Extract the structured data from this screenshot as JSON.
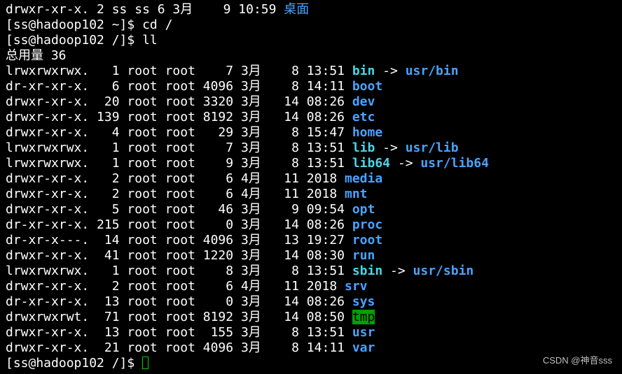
{
  "terminal": {
    "top_line": {
      "prefix": "drwxr-xr-x. 2 ss ss 6 3月    9 10:59 ",
      "name": "桌面"
    },
    "cmd1": "[ss@hadoop102 ~]$ cd /",
    "cmd2": "[ss@hadoop102 /]$ ll",
    "total": "总用量 36",
    "entries": [
      {
        "prefix": "lrwxrwxrwx.   1 root root    7 3月    8 13:51 ",
        "name": "bin",
        "arrow": " -> ",
        "target": "usr/bin"
      },
      {
        "prefix": "dr-xr-xr-x.   6 root root 4096 3月    8 14:11 ",
        "name": "boot",
        "arrow": "",
        "target": ""
      },
      {
        "prefix": "drwxr-xr-x.  20 root root 3320 3月   14 08:26 ",
        "name": "dev",
        "arrow": "",
        "target": ""
      },
      {
        "prefix": "drwxr-xr-x. 139 root root 8192 3月   14 08:26 ",
        "name": "etc",
        "arrow": "",
        "target": ""
      },
      {
        "prefix": "drwxr-xr-x.   4 root root   29 3月    8 15:47 ",
        "name": "home",
        "arrow": "",
        "target": ""
      },
      {
        "prefix": "lrwxrwxrwx.   1 root root    7 3月    8 13:51 ",
        "name": "lib",
        "arrow": " -> ",
        "target": "usr/lib"
      },
      {
        "prefix": "lrwxrwxrwx.   1 root root    9 3月    8 13:51 ",
        "name": "lib64",
        "arrow": " -> ",
        "target": "usr/lib64"
      },
      {
        "prefix": "drwxr-xr-x.   2 root root    6 4月   11 2018 ",
        "name": "media",
        "arrow": "",
        "target": ""
      },
      {
        "prefix": "drwxr-xr-x.   2 root root    6 4月   11 2018 ",
        "name": "mnt",
        "arrow": "",
        "target": ""
      },
      {
        "prefix": "drwxr-xr-x.   5 root root   46 3月    9 09:54 ",
        "name": "opt",
        "arrow": "",
        "target": ""
      },
      {
        "prefix": "dr-xr-xr-x. 215 root root    0 3月   14 08:26 ",
        "name": "proc",
        "arrow": "",
        "target": ""
      },
      {
        "prefix": "dr-xr-x---.  14 root root 4096 3月   13 19:27 ",
        "name": "root",
        "arrow": "",
        "target": ""
      },
      {
        "prefix": "drwxr-xr-x.  41 root root 1220 3月   14 08:30 ",
        "name": "run",
        "arrow": "",
        "target": ""
      },
      {
        "prefix": "lrwxrwxrwx.   1 root root    8 3月    8 13:51 ",
        "name": "sbin",
        "arrow": " -> ",
        "target": "usr/sbin"
      },
      {
        "prefix": "drwxr-xr-x.   2 root root    6 4月   11 2018 ",
        "name": "srv",
        "arrow": "",
        "target": ""
      },
      {
        "prefix": "dr-xr-xr-x.  13 root root    0 3月   14 08:26 ",
        "name": "sys",
        "arrow": "",
        "target": ""
      },
      {
        "prefix": "drwxrwxrwt.  71 root root 8192 3月   14 08:50 ",
        "name": "tmp",
        "arrow": "",
        "target": ""
      },
      {
        "prefix": "drwxr-xr-x.  13 root root  155 3月    8 13:51 ",
        "name": "usr",
        "arrow": "",
        "target": ""
      },
      {
        "prefix": "drwxr-xr-x.  21 root root 4096 3月    8 14:11 ",
        "name": "var",
        "arrow": "",
        "target": ""
      }
    ],
    "prompt": "[ss@hadoop102 /]$ "
  },
  "watermark": "CSDN @神音sss"
}
